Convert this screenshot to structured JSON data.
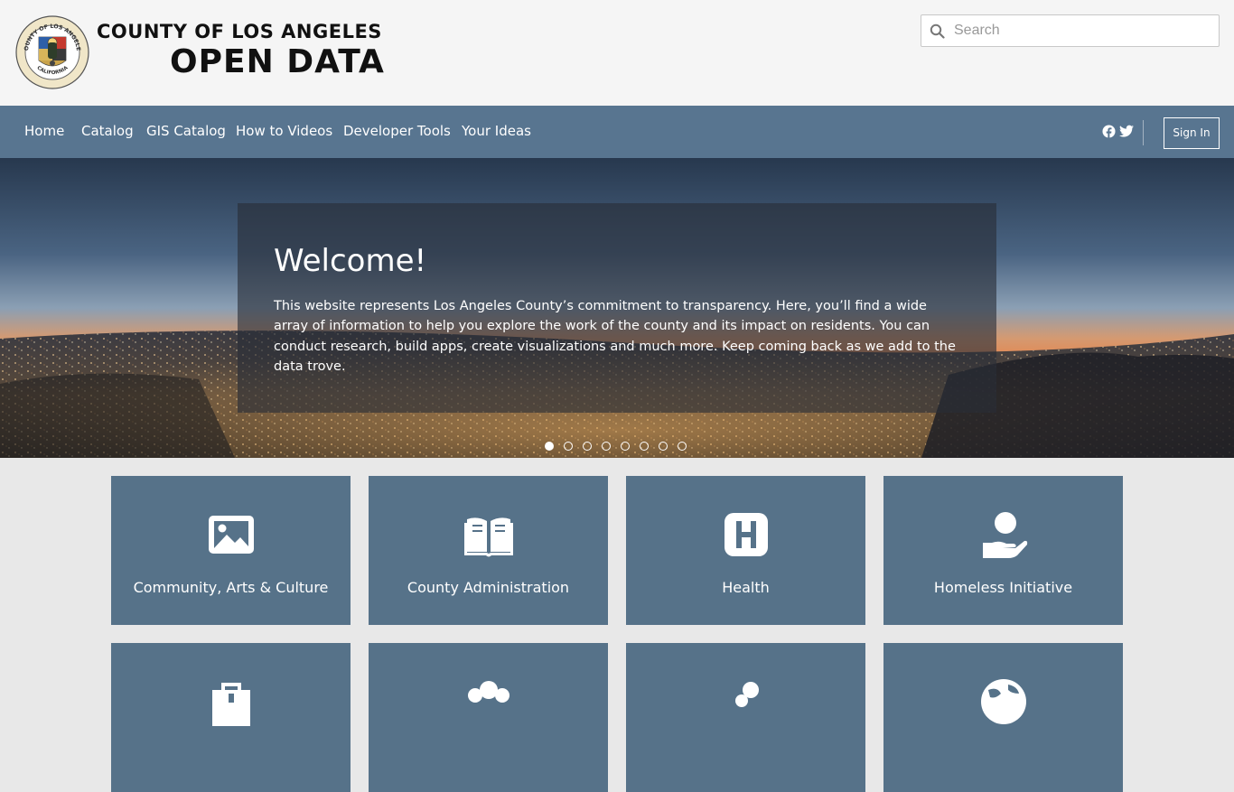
{
  "header": {
    "brand_line1": "COUNTY OF LOS ANGELES",
    "brand_line2": "OPEN DATA",
    "seal": {
      "text_top": "COUNTY OF LOS ANGELES",
      "text_bottom": "CALIFORNIA"
    },
    "search": {
      "placeholder": "Search",
      "value": ""
    }
  },
  "nav": {
    "items": [
      {
        "label": "Home"
      },
      {
        "label": "Catalog"
      },
      {
        "label": "GIS Catalog"
      },
      {
        "label": "How to Videos"
      },
      {
        "label": "Developer Tools"
      },
      {
        "label": "Your Ideas"
      }
    ],
    "social": [
      "facebook-icon",
      "twitter-icon"
    ],
    "sign_in_label": "Sign In"
  },
  "hero": {
    "title": "Welcome!",
    "text": "This website represents Los Angeles County’s commitment to transparency. Here, you’ll find a wide array of information to help you explore the work of the county and its impact on residents. You can conduct research, build apps, create visualizations and much more. Keep coming back as we add to the data trove.",
    "slide_count": 8,
    "active_slide": 1
  },
  "categories": [
    {
      "label": "Community, Arts & Culture",
      "icon": "image-icon"
    },
    {
      "label": "County Administration",
      "icon": "book-open-icon"
    },
    {
      "label": "Health",
      "icon": "hospital-icon"
    },
    {
      "label": "Homeless Initiative",
      "icon": "hand-holding-icon"
    },
    {
      "label": "",
      "icon": ""
    },
    {
      "label": "",
      "icon": ""
    },
    {
      "label": "",
      "icon": ""
    },
    {
      "label": "",
      "icon": ""
    }
  ],
  "colors": {
    "nav_bg": "#587590",
    "tile_bg": "#567289",
    "header_bg": "#f5f5f5",
    "page_bg": "#e8e8e8"
  }
}
